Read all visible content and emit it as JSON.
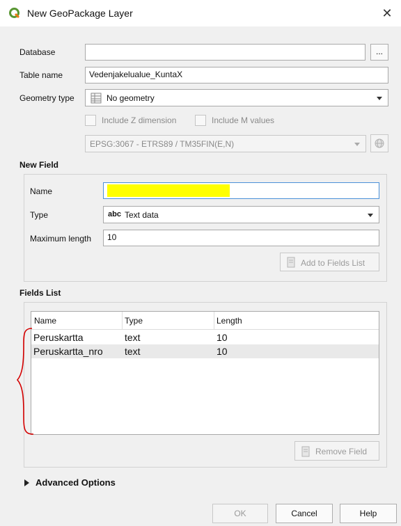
{
  "window": {
    "title": "New GeoPackage Layer",
    "close_glyph": "✕"
  },
  "form": {
    "database_label": "Database",
    "database_value": "",
    "browse_button": "...",
    "table_name_label": "Table name",
    "table_name_value": "Vedenjakelualue_KuntaX",
    "geometry_type_label": "Geometry type",
    "geometry_type_value": "No geometry",
    "include_z_label": "Include Z dimension",
    "include_m_label": "Include M values",
    "crs_value": "EPSG:3067 - ETRS89 / TM35FIN(E,N)"
  },
  "new_field": {
    "section_title": "New Field",
    "name_label": "Name",
    "name_value": "",
    "type_label": "Type",
    "type_prefix": "abc",
    "type_value": "Text data",
    "max_length_label": "Maximum length",
    "max_length_value": "10",
    "add_button": "Add to Fields List",
    "highlight_color": "#ffff00"
  },
  "fields_list": {
    "section_title": "Fields List",
    "columns": [
      "Name",
      "Type",
      "Length"
    ],
    "rows": [
      {
        "name": "Peruskartta",
        "type": "text",
        "length": "10"
      },
      {
        "name": "Peruskartta_nro",
        "type": "text",
        "length": "10"
      }
    ],
    "remove_button": "Remove Field",
    "annotation_color": "#d40000"
  },
  "advanced": {
    "label": "Advanced Options"
  },
  "buttons": {
    "ok": "OK",
    "cancel": "Cancel",
    "help": "Help"
  },
  "icons": {
    "app": "qgis-logo-icon",
    "geometry": "table-icon",
    "add": "add-field-icon",
    "remove": "remove-field-icon",
    "crs": "globe-icon"
  }
}
